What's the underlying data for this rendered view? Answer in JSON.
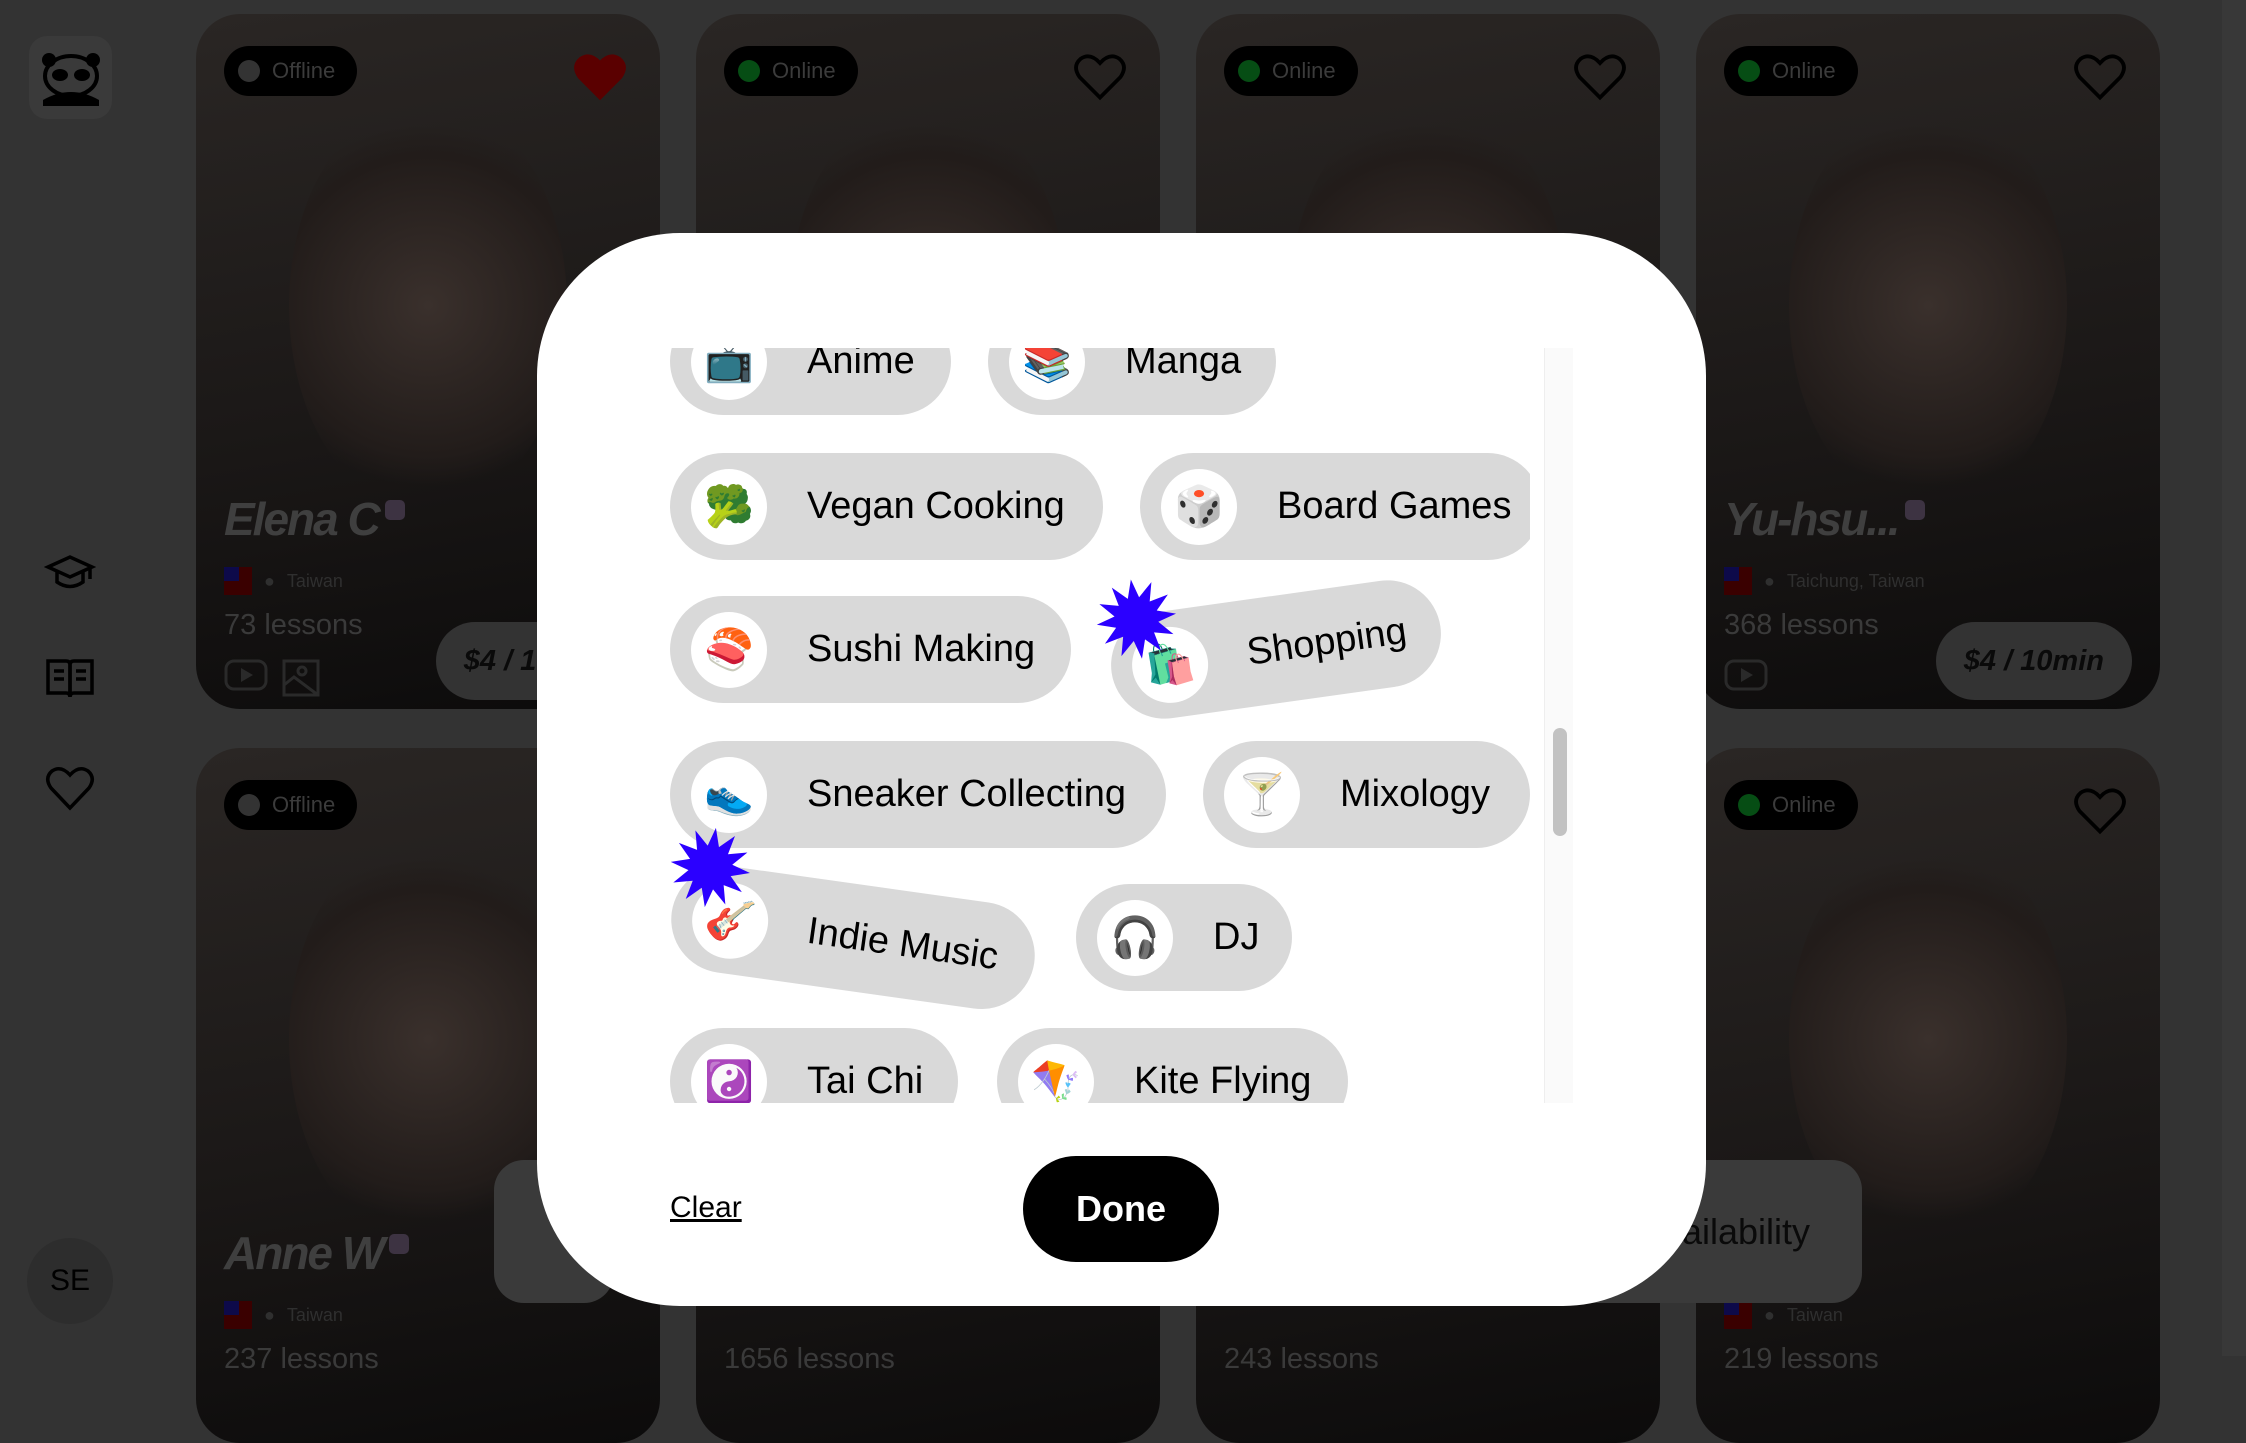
{
  "sidebar": {
    "logo": "panda-logo",
    "icons": [
      "graduation-cap-icon",
      "book-open-icon",
      "heart-icon"
    ],
    "avatar_initials": "SE"
  },
  "cards": [
    {
      "status": "Offline",
      "online": false,
      "favorited": true,
      "name": "Elena C",
      "location": "Taiwan",
      "lessons": "73 lessons",
      "price": "$4 / 10min",
      "video": true,
      "photo": true
    },
    {
      "status": "Online",
      "online": true,
      "favorited": false
    },
    {
      "status": "Online",
      "online": true,
      "favorited": false
    },
    {
      "status": "Online",
      "online": true,
      "favorited": false,
      "name": "Yu-hsu...",
      "location": "Taichung, Taiwan",
      "lessons": "368 lessons",
      "price": "$4 / 10min",
      "video": true,
      "photo": false
    },
    {
      "status": "Offline",
      "online": false,
      "favorited": false,
      "name": "Anne W",
      "location": "Taiwan",
      "lessons": "237 lessons"
    },
    {
      "status": "",
      "online": false,
      "favorited": false,
      "lessons": "1656 lessons"
    },
    {
      "status": "",
      "online": false,
      "favorited": false,
      "lessons": "243 lessons"
    },
    {
      "status": "Online",
      "online": true,
      "favorited": false,
      "location": "Taiwan",
      "lessons": "219 lessons"
    }
  ],
  "background_filter_button": "Availability",
  "modal": {
    "interests": [
      {
        "label": "Anime",
        "emoji": "📺",
        "selected": false
      },
      {
        "label": "Manga",
        "emoji": "📚",
        "selected": false
      },
      {
        "label": "Vegan Cooking",
        "emoji": "🥦",
        "selected": false
      },
      {
        "label": "Board Games",
        "emoji": "🎲",
        "selected": false
      },
      {
        "label": "Sushi Making",
        "emoji": "🍣",
        "selected": false
      },
      {
        "label": "Shopping",
        "emoji": "🛍️",
        "selected": true
      },
      {
        "label": "Sneaker Collecting",
        "emoji": "👟",
        "selected": false
      },
      {
        "label": "Mixology",
        "emoji": "🍸",
        "selected": false
      },
      {
        "label": "Indie Music",
        "emoji": "🎸",
        "selected": true
      },
      {
        "label": "DJ",
        "emoji": "🎧",
        "selected": false
      },
      {
        "label": "Tai Chi",
        "emoji": "☯️",
        "selected": false
      },
      {
        "label": "Kite Flying",
        "emoji": "🪁",
        "selected": false
      }
    ],
    "clear_label": "Clear",
    "done_label": "Done"
  },
  "colors": {
    "selected_burst": "#2b00ff",
    "chip_bg": "#d9d9d9",
    "overlay_bg": "#333333",
    "done_bg": "#000000"
  }
}
